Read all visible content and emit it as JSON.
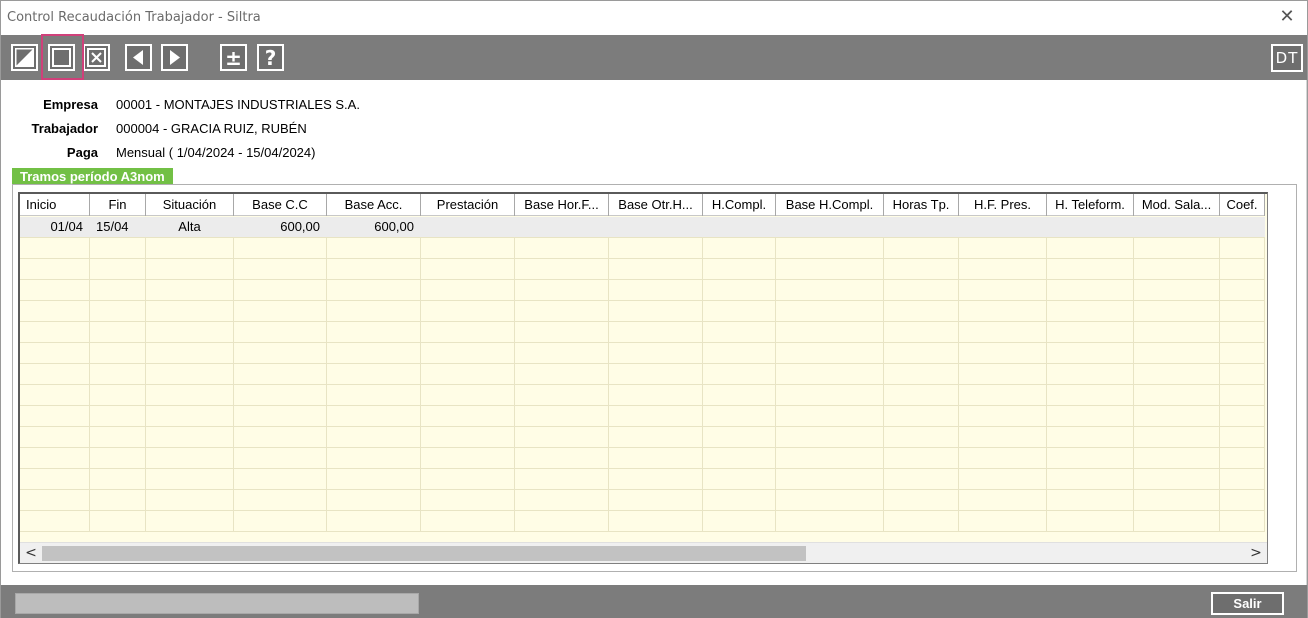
{
  "window": {
    "title": "Control Recaudación Trabajador - Siltra",
    "close_glyph": "✕"
  },
  "toolbar": {
    "buttons": [
      {
        "name": "edit-icon",
        "glyph": "◪"
      },
      {
        "name": "square-icon",
        "glyph": "☐"
      },
      {
        "name": "close-box-icon",
        "glyph": "☒"
      },
      {
        "name": "prev-icon",
        "glyph": "◀"
      },
      {
        "name": "next-icon",
        "glyph": "▶"
      },
      {
        "name": "plus-minus-icon",
        "glyph": "±"
      },
      {
        "name": "help-icon",
        "glyph": "?"
      }
    ],
    "dt_label": "DT"
  },
  "info": {
    "empresa_label": "Empresa",
    "empresa_value": "00001 - MONTAJES INDUSTRIALES S.A.",
    "trabajador_label": "Trabajador",
    "trabajador_value": "000004 - GRACIA RUIZ, RUBÉN",
    "paga_label": "Paga",
    "paga_value": "Mensual ( 1/04/2024 - 15/04/2024)"
  },
  "tab": {
    "label": "Tramos período A3nom"
  },
  "table": {
    "columns": [
      "Inicio",
      "Fin",
      "Situación",
      "Base C.C",
      "Base Acc.",
      "Prestación",
      "Base Hor.F...",
      "Base Otr.H...",
      "H.Compl.",
      "Base H.Compl.",
      "Horas Tp.",
      "H.F. Pres.",
      "H. Teleform.",
      "Mod. Sala...",
      "Coef."
    ],
    "rows": [
      [
        "01/04",
        "15/04",
        "Alta",
        "600,00",
        "600,00",
        "",
        "",
        "",
        "",
        "",
        "",
        "",
        "",
        "",
        ""
      ]
    ]
  },
  "scrollbar": {
    "left_arrow": "<",
    "right_arrow": ">"
  },
  "status": {
    "salir_label": "Salir"
  },
  "colors": {
    "toolbar_bg": "#7c7c7c",
    "grid_bg": "#fffde6",
    "tab_bg": "#72c045",
    "highlight": "#d0407a"
  }
}
